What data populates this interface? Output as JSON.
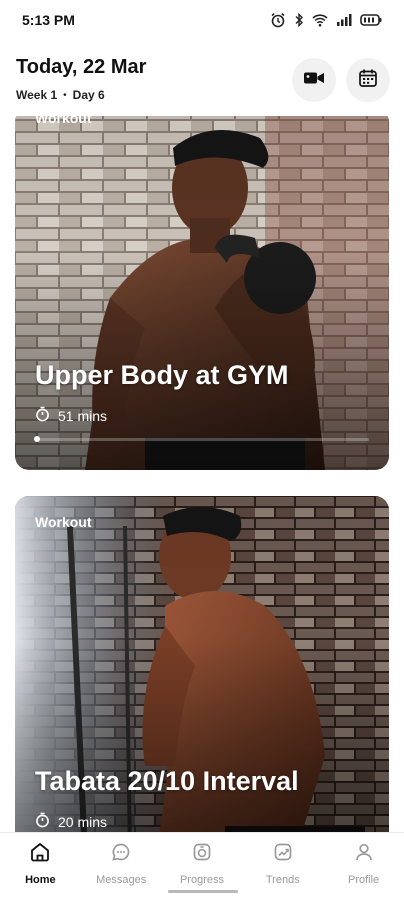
{
  "status": {
    "time": "5:13 PM",
    "icons": [
      "alarm-icon",
      "bluetooth-icon",
      "wifi-icon",
      "signal-icon",
      "battery-icon"
    ]
  },
  "header": {
    "date": "Today, 22 Mar",
    "week": "Week 1",
    "separator": "•",
    "day": "Day 6",
    "buttons": [
      "video-icon",
      "calendar-icon"
    ]
  },
  "cards": [
    {
      "tag": "Workout",
      "title": "Upper Body at GYM",
      "duration": "51 mins",
      "progress": 0.0
    },
    {
      "tag": "Workout",
      "title": "Tabata 20/10 Interval",
      "duration": "20 mins"
    }
  ],
  "nav": {
    "items": [
      {
        "label": "Home",
        "icon": "home-icon",
        "active": true
      },
      {
        "label": "Messages",
        "icon": "messages-icon",
        "active": false
      },
      {
        "label": "Progress",
        "icon": "progress-icon",
        "active": false
      },
      {
        "label": "Trends",
        "icon": "trends-icon",
        "active": false
      },
      {
        "label": "Profile",
        "icon": "profile-icon",
        "active": false
      }
    ]
  },
  "colors": {
    "active": "#111111",
    "inactive": "#9a9a9a",
    "button_bg": "#f1f1f1"
  }
}
